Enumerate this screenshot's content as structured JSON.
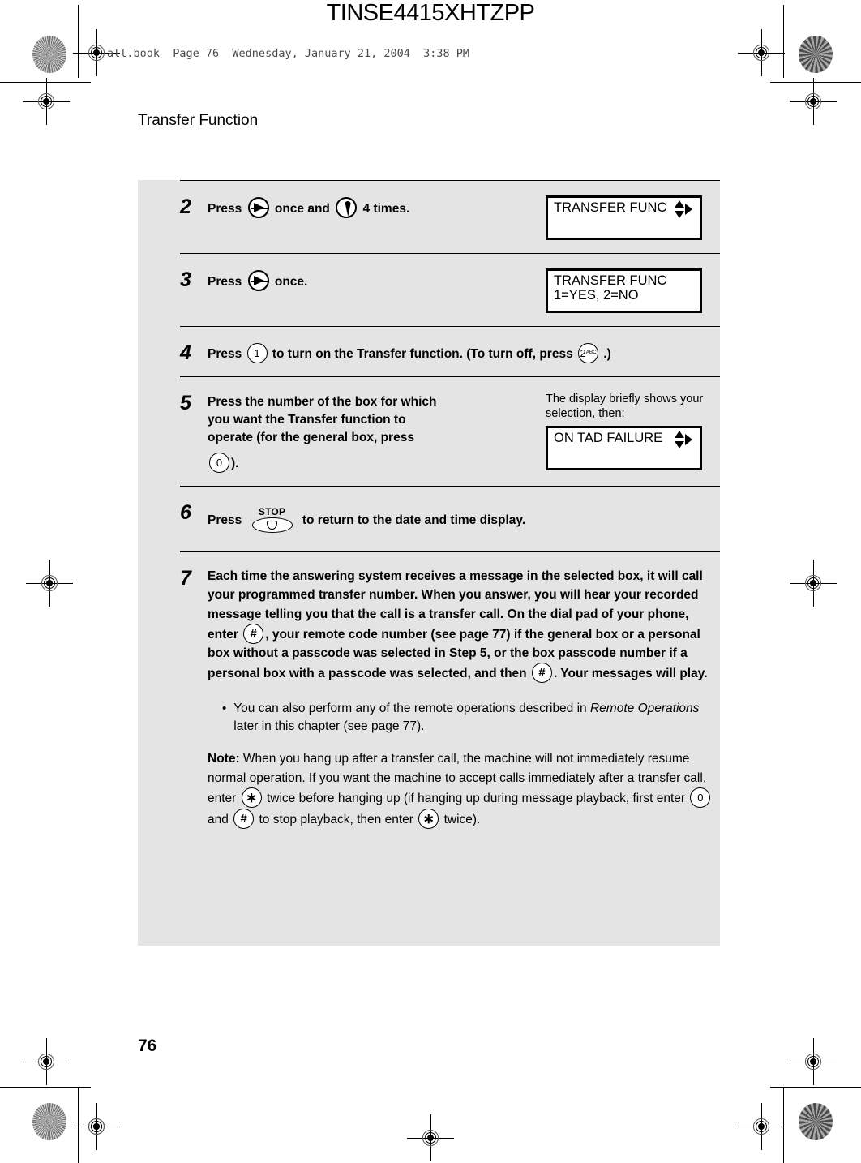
{
  "document": {
    "tinse_code": "TINSE4415XHTZPP",
    "file_header": "all.book  Page 76  Wednesday, January 21, 2004  3:38 PM",
    "running_head": "Transfer Function",
    "page_number": "76",
    "panel_bg": "#e4e4e4"
  },
  "steps": [
    {
      "number": "2",
      "text_before": "Press",
      "text_middle": "once and",
      "text_after": "4 times.",
      "key1": "right-arrow-key",
      "key2": "down-teardrop-key",
      "display": {
        "line1": "TRANSFER FUNC",
        "line2": "",
        "arrows": "up-down-right"
      }
    },
    {
      "number": "3",
      "text_before": "Press",
      "text_after": "once.",
      "key1": "right-arrow-key",
      "display": {
        "line1": "TRANSFER FUNC",
        "line2": "1=YES, 2=NO",
        "arrows": "none"
      }
    },
    {
      "number": "4",
      "text_before": "Press",
      "key1_label": "1",
      "text_middle": "to turn on the Transfer function. (To turn off, press",
      "key2_label": "2",
      "key2_sup": "ABC",
      "text_after": ".)"
    },
    {
      "number": "5",
      "text_line1": "Press the number of the box for which",
      "text_line2": "you want the Transfer function to",
      "text_line3": "operate (for the general box, press",
      "key_label": "0",
      "text_after": ").",
      "hint": "The display briefly shows your selection, then:",
      "display": {
        "line1": "ON TAD FAILURE",
        "line2": "",
        "arrows": "up-down-right"
      }
    },
    {
      "number": "6",
      "text_before": "Press",
      "key_caption": "STOP",
      "text_after": "to return to the date and time display."
    },
    {
      "number": "7",
      "para_1": "Each time the answering system receives a message in the selected box, it will call your programmed transfer number. When you answer, you will hear your recorded message telling you that the call is a transfer call. On the dial pad of your phone, enter",
      "hash_1": "#",
      "para_2": ", your remote code number (see page 77) if the general box or a personal box without a passcode was selected in Step 5, or the box passcode number if a personal box with a passcode was selected, and then",
      "hash_2": "#",
      "para_3": ". Your messages will play.",
      "bullet": {
        "marker": "•",
        "text_1": "You can also perform any of the remote operations described in ",
        "italic_1": "Remote Operations",
        "text_2": " later in this chapter (see page 77)."
      },
      "note": {
        "label": "Note:",
        "text_1": " When you hang up after a transfer call, the machine will not immediately resume normal operation. If you want the machine to accept calls immediately after a transfer call, enter",
        "star_1": "∗",
        "text_2": "twice before hanging up (if hanging up during message playback, first enter",
        "zero_1": "0",
        "text_3": "and",
        "hash_3": "#",
        "text_4": "to stop playback, then enter",
        "star_2": "∗",
        "text_5": "twice)."
      }
    }
  ]
}
